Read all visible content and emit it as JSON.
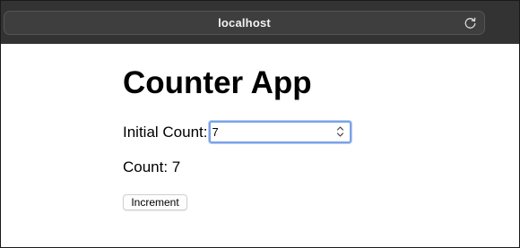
{
  "browser": {
    "url": "localhost",
    "reload_icon": "reload-icon"
  },
  "page": {
    "title": "Counter App",
    "initial_count_label": "Initial Count:",
    "initial_count_value": "7",
    "stepper_icon": "stepper-icon",
    "count_text": "Count: 7",
    "increment_label": "Increment"
  }
}
